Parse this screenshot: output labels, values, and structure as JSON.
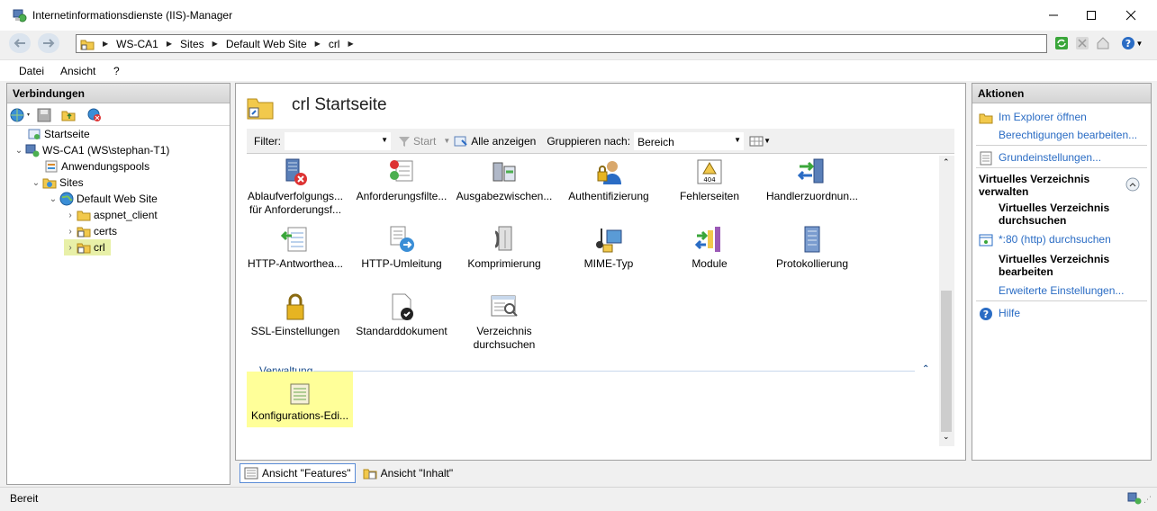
{
  "window": {
    "title": "Internetinformationsdienste (IIS)-Manager",
    "minimize_glyph": "minimize-icon",
    "maximize_glyph": "maximize-icon",
    "close_glyph": "close-icon"
  },
  "address": {
    "crumbs": [
      "WS-CA1",
      "Sites",
      "Default Web Site",
      "crl"
    ]
  },
  "menu": [
    "Datei",
    "Ansicht",
    "?"
  ],
  "connections": {
    "title": "Verbindungen",
    "tree": [
      {
        "label": "Startseite"
      },
      {
        "label": "WS-CA1 (WS\\stephan-T1)"
      },
      {
        "label": "Anwendungspools"
      },
      {
        "label": "Sites"
      },
      {
        "label": "Default Web Site"
      },
      {
        "label": "aspnet_client"
      },
      {
        "label": "certs"
      },
      {
        "label": "crl",
        "selected": true
      }
    ]
  },
  "center": {
    "title": "crl Startseite",
    "filter_label": "Filter:",
    "filter_value": "",
    "start_label": "Start",
    "show_all_label": "Alle anzeigen",
    "group_by_label": "Gruppieren nach:",
    "group_by_value": "Bereich",
    "features": [
      {
        "label1": "Ablaufverfolgungs...",
        "label2": "für Anforderungsf...",
        "icon": "trace-error-icon"
      },
      {
        "label1": "Anforderungsfilte...",
        "label2": "",
        "icon": "request-filter-icon"
      },
      {
        "label1": "Ausgabezwischen...",
        "label2": "",
        "icon": "output-cache-icon"
      },
      {
        "label1": "Authentifizierung",
        "label2": "",
        "icon": "authentication-icon"
      },
      {
        "label1": "Fehlerseiten",
        "label2": "",
        "icon": "error-pages-icon"
      },
      {
        "label1": "Handlerzuordnun...",
        "label2": "",
        "icon": "handler-mappings-icon"
      },
      {
        "label1": "HTTP-Antworthea...",
        "label2": "",
        "icon": "http-response-headers-icon"
      },
      {
        "label1": "HTTP-Umleitung",
        "label2": "",
        "icon": "http-redirect-icon"
      },
      {
        "label1": "Komprimierung",
        "label2": "",
        "icon": "compression-icon"
      },
      {
        "label1": "MIME-Typ",
        "label2": "",
        "icon": "mime-types-icon"
      },
      {
        "label1": "Module",
        "label2": "",
        "icon": "modules-icon"
      },
      {
        "label1": "Protokollierung",
        "label2": "",
        "icon": "logging-icon"
      },
      {
        "label1": "SSL-Einstellungen",
        "label2": "",
        "icon": "ssl-lock-icon"
      },
      {
        "label1": "Standarddokument",
        "label2": "",
        "icon": "default-document-icon"
      },
      {
        "label1": "Verzeichnis",
        "label2": "durchsuchen",
        "icon": "directory-browsing-icon"
      }
    ],
    "group_name": "Verwaltung",
    "management_features": [
      {
        "label1": "Konfigurations-Edi...",
        "icon": "configuration-editor-icon"
      }
    ],
    "tab_features": "Ansicht \"Features\"",
    "tab_content": "Ansicht \"Inhalt\""
  },
  "actions": {
    "title": "Aktionen",
    "explore": "Im Explorer öffnen",
    "edit_permissions": "Berechtigungen bearbeiten...",
    "basic_settings": "Grundeinstellungen...",
    "manage_header_1": "Virtuelles Verzeichnis",
    "manage_header_2": "verwalten",
    "browse_header_1": "Virtuelles Verzeichnis",
    "browse_header_2": "durchsuchen",
    "browse_link": "*:80 (http) durchsuchen",
    "edit_header_1": "Virtuelles Verzeichnis",
    "edit_header_2": "bearbeiten",
    "advanced_settings": "Erweiterte Einstellungen...",
    "help": "Hilfe"
  },
  "status": {
    "text": "Bereit"
  },
  "colors": {
    "link": "#2a6cc4",
    "selection": "#e8f0a8",
    "highlight": "#ffff99",
    "group": "#1c4d8a"
  }
}
